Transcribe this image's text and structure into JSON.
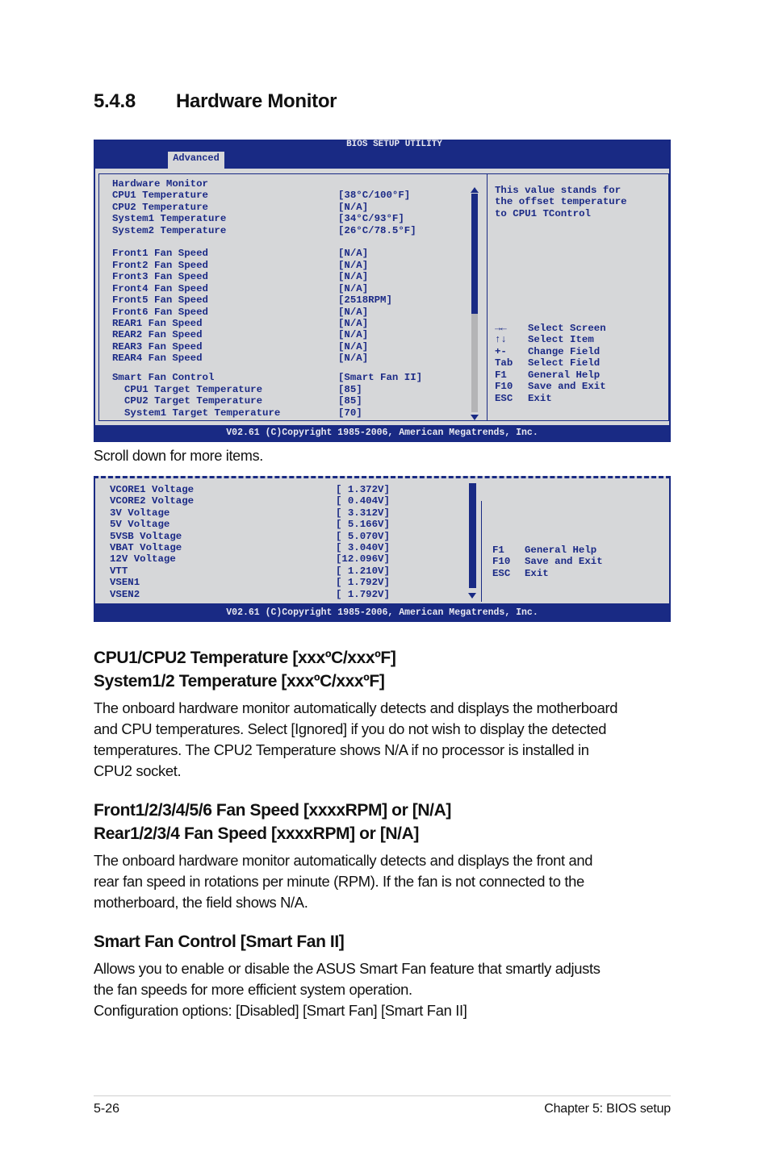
{
  "section": {
    "number": "5.4.8",
    "title": "Hardware Monitor"
  },
  "bios1": {
    "title": "BIOS SETUP UTILITY",
    "active_tab": "Advanced",
    "heading": "Hardware Monitor",
    "items": [
      {
        "label": "CPU1 Temperature",
        "value": "[38°C/100°F]"
      },
      {
        "label": "CPU2 Temperature",
        "value": "[N/A]"
      },
      {
        "label": "System1 Temperature",
        "value": "[34°C/93°F]"
      },
      {
        "label": "System2 Temperature",
        "value": "[26°C/78.5°F]"
      },
      {
        "label": "Front1 Fan Speed",
        "value": "[N/A]"
      },
      {
        "label": "Front2 Fan Speed",
        "value": "[N/A]"
      },
      {
        "label": "Front3 Fan Speed",
        "value": "[N/A]"
      },
      {
        "label": "Front4 Fan Speed",
        "value": "[N/A]"
      },
      {
        "label": "Front5 Fan Speed",
        "value": "[2518RPM]"
      },
      {
        "label": "Front6 Fan Speed",
        "value": "[N/A]"
      },
      {
        "label": "REAR1 Fan Speed",
        "value": "[N/A]"
      },
      {
        "label": "REAR2 Fan Speed",
        "value": "[N/A]"
      },
      {
        "label": "REAR3 Fan Speed",
        "value": "[N/A]"
      },
      {
        "label": "REAR4 Fan Speed",
        "value": "[N/A]"
      },
      {
        "label": "Smart Fan Control",
        "value": "[Smart Fan II]"
      },
      {
        "label": "CPU1 Target Temperature",
        "value": "[85]"
      },
      {
        "label": "CPU2 Target Temperature",
        "value": "[85]"
      },
      {
        "label": "System1 Target Temperature",
        "value": "[70]"
      }
    ],
    "help_text": [
      "This value stands for",
      "the offset temperature",
      "to CPU1 TControl"
    ],
    "keys": [
      {
        "key": "→←",
        "action": "Select Screen"
      },
      {
        "key": "↑↓",
        "action": "Select Item"
      },
      {
        "key": "+-",
        "action": "Change Field"
      },
      {
        "key": "Tab",
        "action": "Select Field"
      },
      {
        "key": "F1",
        "action": "General Help"
      },
      {
        "key": "F10",
        "action": "Save and Exit"
      },
      {
        "key": "ESC",
        "action": "Exit"
      }
    ],
    "scroll_position": 0.55,
    "footer": "V02.61 (C)Copyright 1985-2006, American Megatrends, Inc."
  },
  "scroll_note": "Scroll down for more items.",
  "bios2": {
    "items": [
      {
        "label": "VCORE1 Voltage",
        "value": "[ 1.372V]"
      },
      {
        "label": "VCORE2 Voltage",
        "value": "[ 0.404V]"
      },
      {
        "label": "3V Voltage",
        "value": "[ 3.312V]"
      },
      {
        "label": "5V Voltage",
        "value": "[ 5.166V]"
      },
      {
        "label": "5VSB Voltage",
        "value": "[ 5.070V]"
      },
      {
        "label": "VBAT Voltage",
        "value": "[ 3.040V]"
      },
      {
        "label": "12V Voltage",
        "value": "[12.096V]"
      },
      {
        "label": "VTT",
        "value": "[ 1.210V]"
      },
      {
        "label": "VSEN1",
        "value": "[ 1.792V]"
      },
      {
        "label": "VSEN2",
        "value": "[ 1.792V]"
      }
    ],
    "keys": [
      {
        "key": "F1",
        "action": "General Help"
      },
      {
        "key": "F10",
        "action": "Save and Exit"
      },
      {
        "key": "ESC",
        "action": "Exit"
      }
    ],
    "footer": "V02.61 (C)Copyright 1985-2006, American Megatrends, Inc."
  },
  "sections": [
    {
      "heading_lines": [
        "CPU1/CPU2 Temperature [xxxºC/xxxºF]",
        "System1/2 Temperature [xxxºC/xxxºF]"
      ],
      "body": [
        "The onboard hardware monitor automatically detects and displays the motherboard",
        "and CPU temperatures. Select [Ignored] if you do not wish to display the detected",
        "temperatures. The CPU2 Temperature shows N/A if no processor is installed in",
        "CPU2 socket."
      ]
    },
    {
      "heading_lines": [
        "Front1/2/3/4/5/6 Fan Speed [xxxxRPM] or [N/A]",
        "Rear1/2/3/4 Fan Speed [xxxxRPM] or [N/A]"
      ],
      "body": [
        "The onboard hardware monitor automatically detects and displays the front and",
        "rear fan speed in rotations per minute (RPM). If the fan is not connected to the",
        "motherboard, the field shows N/A."
      ]
    },
    {
      "heading_lines": [
        "Smart Fan Control [Smart Fan II]"
      ],
      "body": [
        "Allows you to enable or disable the ASUS Smart Fan feature that smartly adjusts",
        "the fan speeds for more efficient system operation.",
        "Configuration options: [Disabled] [Smart Fan] [Smart Fan II]"
      ]
    }
  ],
  "page_footer": {
    "page_number": "5-26",
    "chapter": "Chapter 5: BIOS setup"
  }
}
